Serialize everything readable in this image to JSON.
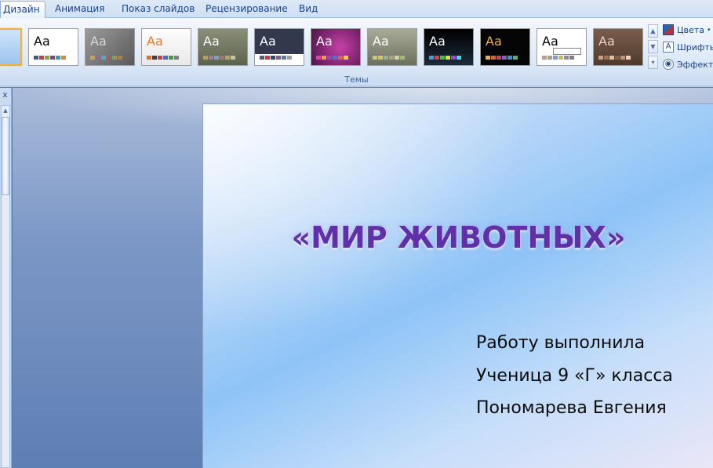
{
  "tabs": [
    {
      "label": "Дизайн",
      "active": true
    },
    {
      "label": "Анимация",
      "active": false
    },
    {
      "label": "Показ слайдов",
      "active": false
    },
    {
      "label": "Рецензирование",
      "active": false
    },
    {
      "label": "Вид",
      "active": false
    }
  ],
  "themes": {
    "group_label": "Темы",
    "items": [
      {
        "text": "",
        "bg": "linear-gradient(#cfe4fa,#9cc4ef)",
        "fg": "#1d3f7a",
        "selected": true
      },
      {
        "text": "Aa",
        "bg": "#ffffff",
        "fg": "#000000",
        "selected": false
      },
      {
        "text": "Aa",
        "bg": "linear-gradient(135deg,#9a9a9a,#5a5a5a)",
        "fg": "#d8d8d8",
        "selected": false
      },
      {
        "text": "Aa",
        "bg": "linear-gradient(#fdfdfd,#e9e9e9)",
        "fg": "#e8762c",
        "selected": false
      },
      {
        "text": "Aa",
        "bg": "linear-gradient(#8a8f78,#5e634f)",
        "fg": "#ffffff",
        "selected": false
      },
      {
        "text": "Aa",
        "bg": "linear-gradient(#33394d 70%,#ffffff 70%)",
        "fg": "#ffffff",
        "selected": false
      },
      {
        "text": "Aa",
        "bg": "radial-gradient(circle at 60% 50%,#c640a8,#4d1448)",
        "fg": "#ffffff",
        "selected": false
      },
      {
        "text": "Aa",
        "bg": "linear-gradient(#a8ab98,#6d705e)",
        "fg": "#ffffff",
        "selected": false
      },
      {
        "text": "Aa",
        "bg": "linear-gradient(#000000,#1c2a3a)",
        "fg": "#ffffff",
        "selected": false
      },
      {
        "text": "Aa",
        "bg": "#050505",
        "fg": "#f0b040",
        "selected": false
      },
      {
        "text": "Aa",
        "bg": "#ffffff",
        "fg": "#000000",
        "selected": false
      },
      {
        "text": "Aa",
        "bg": "linear-gradient(#7a5e4c,#4e3a2e)",
        "fg": "#e8d4c2",
        "selected": false
      }
    ]
  },
  "options": {
    "colors_label": "Цвета",
    "fonts_label": "Шрифты",
    "effects_label": "Эффекты"
  },
  "slide": {
    "title": "«МИР ЖИВОТНЫХ»",
    "lines": [
      "Работу выполнила",
      "Ученица 9 «Г» класса",
      "Пономарева Евгения"
    ]
  }
}
